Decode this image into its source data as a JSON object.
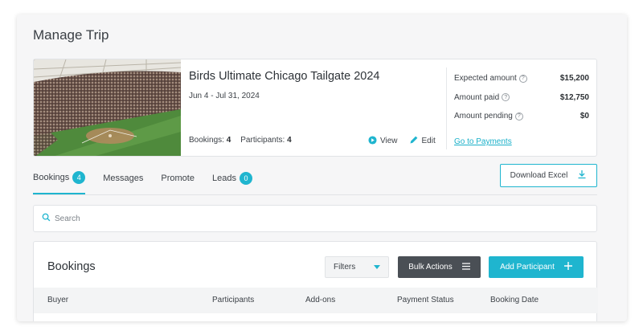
{
  "page": {
    "title": "Manage Trip"
  },
  "trip": {
    "name": "Birds Ultimate Chicago Tailgate 2024",
    "dates": "Jun 4 - Jul 31, 2024",
    "bookings_label": "Bookings:",
    "bookings_count": "4",
    "participants_label": "Participants:",
    "participants_count": "4",
    "view_label": "View",
    "edit_label": "Edit"
  },
  "amounts": {
    "expected_label": "Expected amount",
    "expected_value": "$15,200",
    "paid_label": "Amount paid",
    "paid_value": "$12,750",
    "pending_label": "Amount pending",
    "pending_value": "$0",
    "help_glyph": "?",
    "goto_payments": "Go to Payments"
  },
  "tabs": [
    {
      "label": "Bookings",
      "badge": "4"
    },
    {
      "label": "Messages"
    },
    {
      "label": "Promote"
    },
    {
      "label": "Leads",
      "badge": "0"
    }
  ],
  "download_excel": "Download Excel",
  "search": {
    "placeholder": "Search"
  },
  "bookings_panel": {
    "title": "Bookings",
    "filters_label": "Filters",
    "bulk_actions_label": "Bulk Actions",
    "add_participant_label": "Add Participant",
    "columns": [
      "Buyer",
      "Participants",
      "Add-ons",
      "Payment Status",
      "Booking Date"
    ]
  },
  "colors": {
    "accent": "#1fb5cf",
    "dark_button": "#4a4f55",
    "link": "#1ab0c9"
  }
}
